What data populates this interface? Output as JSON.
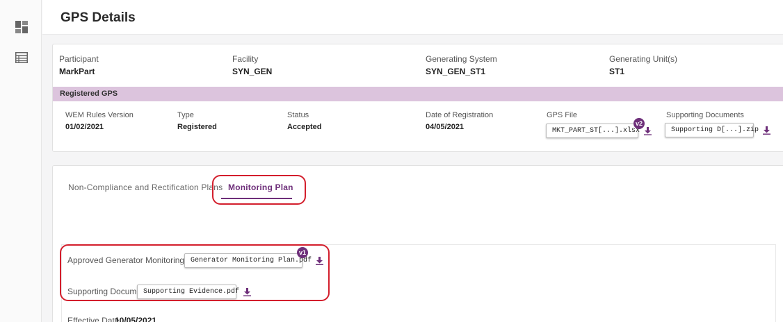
{
  "page": {
    "title": "GPS Details"
  },
  "rail": {
    "items": [
      {
        "icon": "dashboard-icon"
      },
      {
        "icon": "table-list-icon"
      }
    ]
  },
  "details": {
    "participant": {
      "label": "Participant",
      "value": "MarkPart"
    },
    "facility": {
      "label": "Facility",
      "value": "SYN_GEN"
    },
    "generating_system": {
      "label": "Generating System",
      "value": "SYN_GEN_ST1"
    },
    "generating_units": {
      "label": "Generating Unit(s)",
      "value": "ST1"
    }
  },
  "registered_gps": {
    "heading": "Registered GPS",
    "wem_rules_version": {
      "label": "WEM Rules Version",
      "value": "01/02/2021"
    },
    "type": {
      "label": "Type",
      "value": "Registered"
    },
    "status": {
      "label": "Status",
      "value": "Accepted"
    },
    "date_of_registration": {
      "label": "Date of Registration",
      "value": "04/05/2021"
    },
    "gps_file": {
      "label": "GPS File",
      "file": "MKT_PART_ST[...].xlsx",
      "version": "v2"
    },
    "supporting_documents": {
      "label": "Supporting Documents",
      "file": "Supporting D[...].zip"
    }
  },
  "tabs": [
    {
      "label": "Non-Compliance and Rectification Plans",
      "active": false
    },
    {
      "label": "Monitoring Plan",
      "active": true
    }
  ],
  "monitoring_plan": {
    "approved_plan": {
      "label": "Approved Generator Monitoring Plan",
      "file": "Generator Monitoring Plan.pdf",
      "version": "v1"
    },
    "supporting_documents": {
      "label": "Supporting Documents",
      "file": "Supporting Evidence.pdf"
    },
    "effective_date": {
      "label": "Effective Date",
      "value": "10/05/2021"
    }
  },
  "colors": {
    "accent": "#6e2f7a",
    "band": "#dcc4dd",
    "highlight": "#d31e2c"
  }
}
